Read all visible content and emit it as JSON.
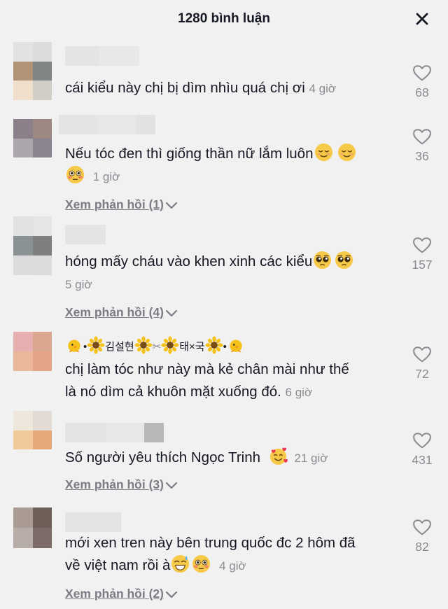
{
  "header": {
    "title": "1280 bình luận"
  },
  "comments": [
    {
      "text": "cái kiểu này chị bị dìm nhìu quá chị ơi",
      "time": "4 giờ",
      "likes": "68"
    },
    {
      "text": "Nếu tóc đen thì giống thần nữ lắm luôn",
      "time": "1 giờ",
      "likes": "36",
      "reply": "Xem phản hồi (1)"
    },
    {
      "text": "hóng mấy cháu vào khen xinh các kiểu",
      "time": "5 giờ",
      "likes": "157",
      "reply": "Xem phản hồi (4)"
    },
    {
      "username": {
        "first": "김설현",
        "second": "태×국"
      },
      "text_line1": "chị làm tóc như này mà kẻ chân mài như thế",
      "text_line2": "là nó dìm cả khuôn mặt xuống đó.",
      "time": "6 giờ",
      "likes": "72"
    },
    {
      "text": "Số người yêu thích Ngọc Trinh",
      "time": "21 giờ",
      "likes": "431",
      "reply": "Xem phản hồi (3)"
    },
    {
      "text_line1": "mới xen tren này bên trung quốc đc 2 hôm đã",
      "text_line2": "về việt nam rồi à",
      "time": "4 giờ",
      "likes": "82",
      "reply": "Xem phản hồi (2)"
    }
  ],
  "icons": {
    "close": "close-icon",
    "like": "heart-outline-icon",
    "chevron": "chevron-down-icon",
    "relieved": "relieved-face-emoji",
    "flushed": "flushed-face-emoji",
    "pleading": "pleading-face-emoji",
    "hearts": "smiling-face-with-hearts-emoji",
    "sweat": "grinning-face-with-sweat-emoji",
    "chick": "chick-emoji",
    "sunflower": "sunflower-emoji",
    "scissors": "scissors-emoji"
  },
  "colors": {
    "background": "#f1f1f2",
    "text": "#161823",
    "muted": "#8a8b91"
  }
}
